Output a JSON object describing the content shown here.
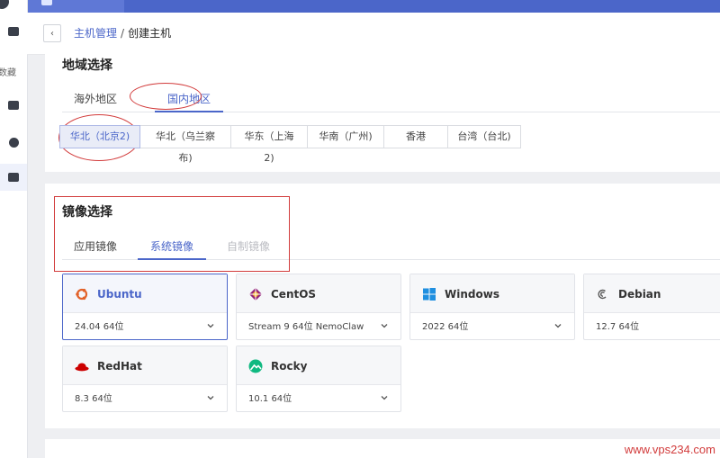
{
  "breadcrumb": {
    "back_symbol": "‹",
    "parent": "主机管理",
    "separator": "/",
    "current": "创建主机"
  },
  "sidebar": {
    "items": [
      {
        "icon": "monitor-icon"
      },
      {
        "label": "数藏",
        "icon": "collection-icon"
      },
      {
        "icon": "storage-add-icon"
      },
      {
        "icon": "network-icon"
      },
      {
        "icon": "server-list-icon",
        "active": true
      }
    ]
  },
  "region_section": {
    "title": "地域选择",
    "tabs": [
      {
        "label": "海外地区",
        "active": false
      },
      {
        "label": "国内地区",
        "active": true
      }
    ],
    "regions": [
      {
        "label": "华北（北京2)",
        "active": true
      },
      {
        "label": "华北（乌兰察布)",
        "active": false
      },
      {
        "label": "华东（上海2)",
        "active": false
      },
      {
        "label": "华南（广州)",
        "active": false
      },
      {
        "label": "香港",
        "active": false
      },
      {
        "label": "台湾（台北)",
        "active": false
      }
    ]
  },
  "image_section": {
    "title": "镜像选择",
    "tabs": [
      {
        "label": "应用镜像",
        "state": "normal"
      },
      {
        "label": "系统镜像",
        "state": "active"
      },
      {
        "label": "自制镜像",
        "state": "disabled"
      }
    ],
    "images": [
      {
        "name": "Ubuntu",
        "version": "24.04 64位",
        "icon": "ubuntu-icon",
        "selected": true
      },
      {
        "name": "CentOS",
        "version": "Stream 9 64位 NemoClaw",
        "icon": "centos-icon",
        "selected": false
      },
      {
        "name": "Windows",
        "version": "2022 64位",
        "icon": "windows-icon",
        "selected": false
      },
      {
        "name": "Debian",
        "version": "12.7 64位",
        "icon": "debian-icon",
        "selected": false
      },
      {
        "name": "RedHat",
        "version": "8.3 64位",
        "icon": "redhat-icon",
        "selected": false
      },
      {
        "name": "Rocky",
        "version": "10.1 64位",
        "icon": "rocky-icon",
        "selected": false
      }
    ]
  },
  "watermark": "www.vps234.com",
  "colors": {
    "accent": "#4b66c9",
    "annotation": "#d23b3b"
  }
}
